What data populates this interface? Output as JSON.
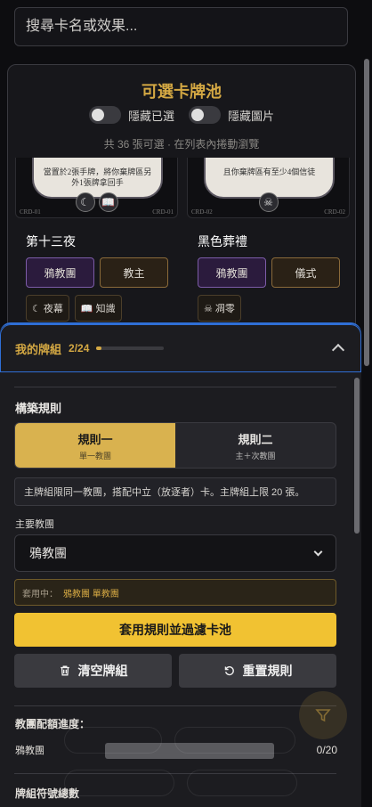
{
  "search": {
    "placeholder": "搜尋卡名或效果..."
  },
  "pool": {
    "title": "可選卡牌池",
    "toggle_hide_selected": "隱藏已選",
    "toggle_hide_images": "隱藏圖片",
    "summary": "共 36 張可選 · 在列表內捲動瀏覽",
    "cards": [
      {
        "art_text": "當置於2張手牌，將你棄牌區另外1張牌拿回手",
        "code_left": "CRD-01",
        "code_right": "CRD-01",
        "icons": [
          "☾",
          "📖"
        ],
        "name": "第十三夜",
        "tags": [
          "鴉教團",
          "教主"
        ],
        "keywords": [
          {
            "icon": "☾",
            "label": "夜幕"
          },
          {
            "icon": "📖",
            "label": "知識"
          }
        ]
      },
      {
        "art_text": "且你棄牌區有至少4個信徒",
        "code_left": "CRD-02",
        "code_right": "CRD-02",
        "icons": [
          "☠"
        ],
        "name": "黑色葬禮",
        "tags": [
          "鴉教團",
          "儀式"
        ],
        "keywords": [
          {
            "icon": "☠",
            "label": "凋零"
          }
        ]
      }
    ]
  },
  "deck": {
    "title": "我的牌組",
    "count": "2/24",
    "progress_fraction": 0.083,
    "build_rules_title": "構築規則",
    "rule_tabs": [
      {
        "label": "規則一",
        "sub": "單一教團",
        "active": true
      },
      {
        "label": "規則二",
        "sub": "主＋次教團",
        "active": false
      }
    ],
    "rule_desc": "主牌組限同一教團，搭配中立（放逐者）卡。主牌組上限 20 張。",
    "main_cult_label": "主要教團",
    "main_cult_value": "鴉教團",
    "applying_label": "套用中：",
    "applying_value": "鴉教團 單教團",
    "apply_button": "套用規則並過濾卡池",
    "clear_button": "清空牌組",
    "reset_button": "重置規則",
    "quota_title": "教團配額進度：",
    "quota_rows": [
      {
        "name": "鴉教團",
        "count": "0/20"
      }
    ],
    "symbol_title": "牌組符號總數"
  },
  "colors": {
    "accent": "#d4a843",
    "focus_blue": "#2f6fd6",
    "apply_yellow": "#f1c232"
  }
}
